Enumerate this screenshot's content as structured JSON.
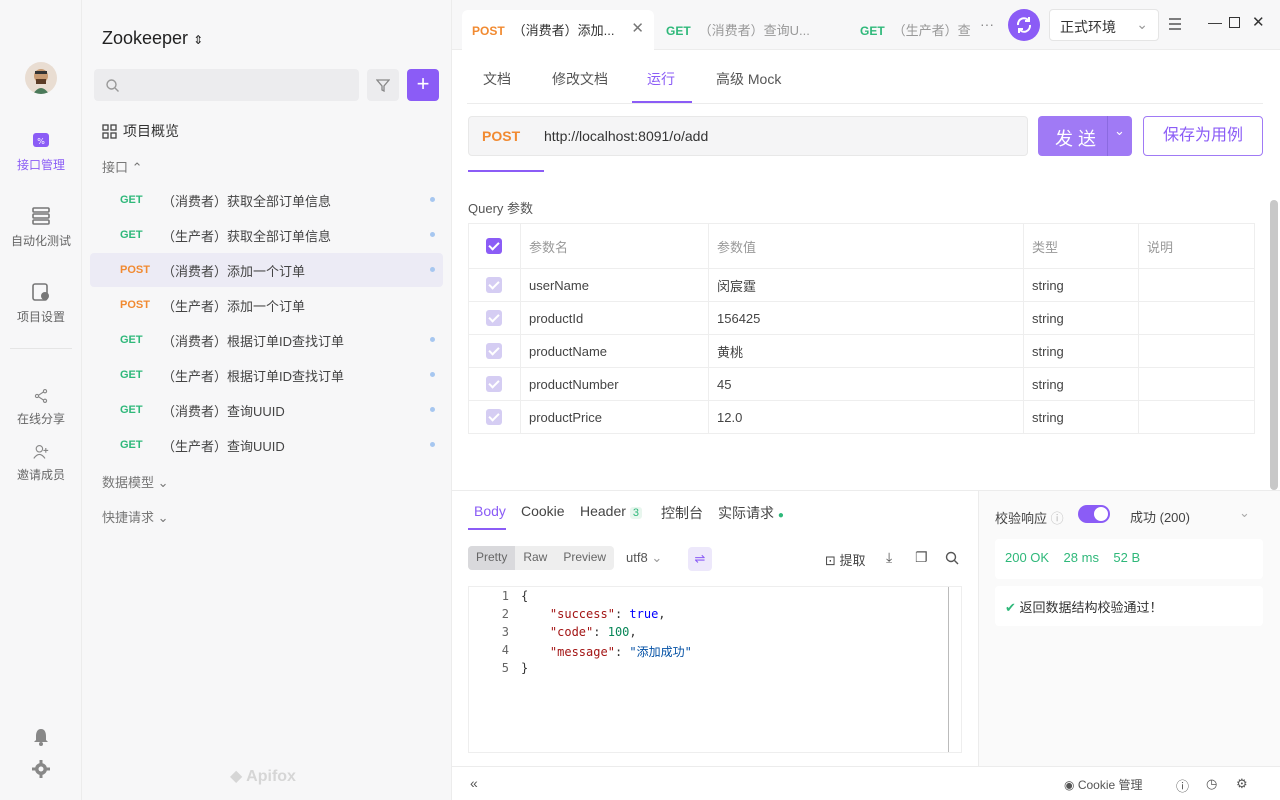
{
  "project": {
    "title": "Zookeeper"
  },
  "rail": [
    {
      "label": "接口管理",
      "active": true
    },
    {
      "label": "自动化测试"
    },
    {
      "label": "项目设置"
    },
    {
      "label": "在线分享"
    },
    {
      "label": "邀请成员"
    }
  ],
  "sidebar": {
    "overview": "项目概览",
    "api_section": "接口",
    "apis": [
      {
        "method": "GET",
        "name": "（消费者）获取全部订单信息"
      },
      {
        "method": "GET",
        "name": "（生产者）获取全部订单信息"
      },
      {
        "method": "POST",
        "name": "（消费者）添加一个订单"
      },
      {
        "method": "POST",
        "name": "（生产者）添加一个订单"
      },
      {
        "method": "GET",
        "name": "（消费者）根据订单ID查找订单"
      },
      {
        "method": "GET",
        "name": "（生产者）根据订单ID查找订单"
      },
      {
        "method": "GET",
        "name": "（消费者）查询UUID"
      },
      {
        "method": "GET",
        "name": "（生产者）查询UUID"
      }
    ],
    "data_models": "数据模型",
    "quick_requests": "快捷请求",
    "brand": "Apifox"
  },
  "tabs": [
    {
      "method": "POST",
      "name": "（消费者）添加..."
    },
    {
      "method": "GET",
      "name": "（消费者）查询U..."
    },
    {
      "method": "GET",
      "name": "（生产者）查"
    }
  ],
  "env": {
    "value": "正式环境"
  },
  "subtabs": [
    "文档",
    "修改文档",
    "运行",
    "高级 Mock"
  ],
  "request": {
    "method": "POST",
    "url": "http://localhost:8091/o/add",
    "send_label": "发 送",
    "save_label": "保存为用例"
  },
  "query": {
    "title": "Query 参数",
    "headers": [
      "参数名",
      "参数值",
      "类型",
      "说明"
    ],
    "rows": [
      {
        "name": "userName",
        "value": "闵宸霆",
        "type": "string",
        "desc": ""
      },
      {
        "name": "productId",
        "value": "156425",
        "type": "string",
        "desc": ""
      },
      {
        "name": "productName",
        "value": "黄桃",
        "type": "string",
        "desc": ""
      },
      {
        "name": "productNumber",
        "value": "45",
        "type": "string",
        "desc": ""
      },
      {
        "name": "productPrice",
        "value": "12.0",
        "type": "string",
        "desc": ""
      }
    ]
  },
  "response": {
    "tabs": [
      "Body",
      "Cookie",
      "Header",
      "控制台",
      "实际请求"
    ],
    "header_count": "3",
    "formats": [
      "Pretty",
      "Raw",
      "Preview"
    ],
    "encoding": "utf8",
    "extract": "提取",
    "code_lines": [
      "1",
      "2",
      "3",
      "4",
      "5"
    ],
    "json": {
      "success": "true",
      "code": "100",
      "message": "\"添加成功\""
    },
    "validate_label": "校验响应",
    "validate_result": "成功 (200)",
    "status": "200 OK",
    "time": "28 ms",
    "size": "52 B",
    "validate_msg": "返回数据结构校验通过！"
  },
  "statusbar": {
    "cookie": "Cookie 管理"
  }
}
